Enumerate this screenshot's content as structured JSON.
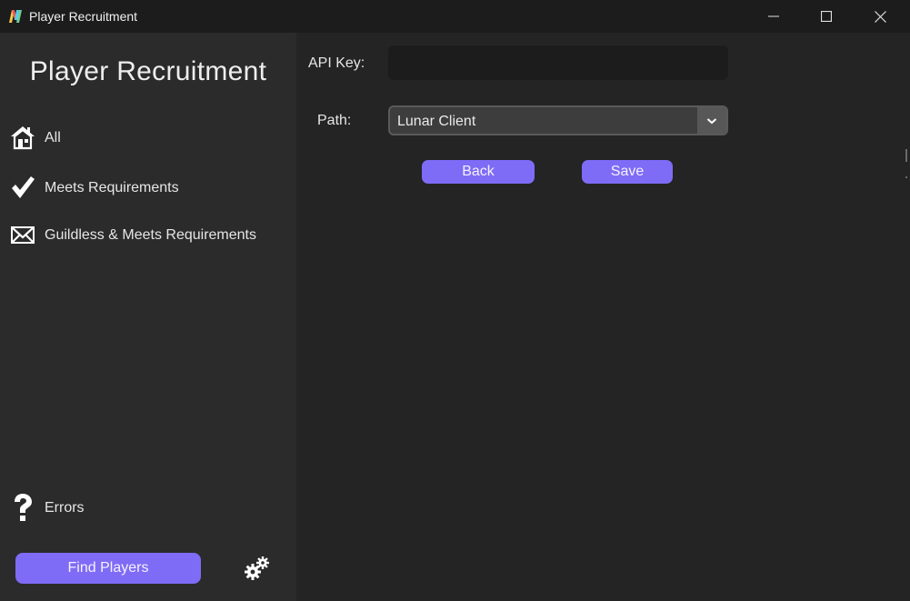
{
  "window": {
    "title": "Player Recruitment",
    "controls": {
      "minimize_icon": "minimize-icon",
      "maximize_icon": "maximize-icon",
      "close_icon": "close-icon"
    }
  },
  "sidebar": {
    "title": "Player Recruitment",
    "items": [
      {
        "label": "All",
        "icon": "home-icon"
      },
      {
        "label": "Meets Requirements",
        "icon": "checkmark-icon"
      },
      {
        "label": "Guildless & Meets Requirements",
        "icon": "envelope-icon"
      },
      {
        "label": "Errors",
        "icon": "question-mark-icon"
      }
    ],
    "find_button": "Find Players",
    "settings_icon": "gears-icon"
  },
  "main": {
    "api_key_label": "API Key:",
    "api_key_value": "",
    "path_label": "Path:",
    "path_value": "Lunar Client",
    "back_label": "Back",
    "save_label": "Save"
  },
  "colors": {
    "accent": "#7e6cf6",
    "sidebar_bg": "#2b2b2b",
    "main_bg": "#242424",
    "titlebar_bg": "#1c1c1c"
  }
}
